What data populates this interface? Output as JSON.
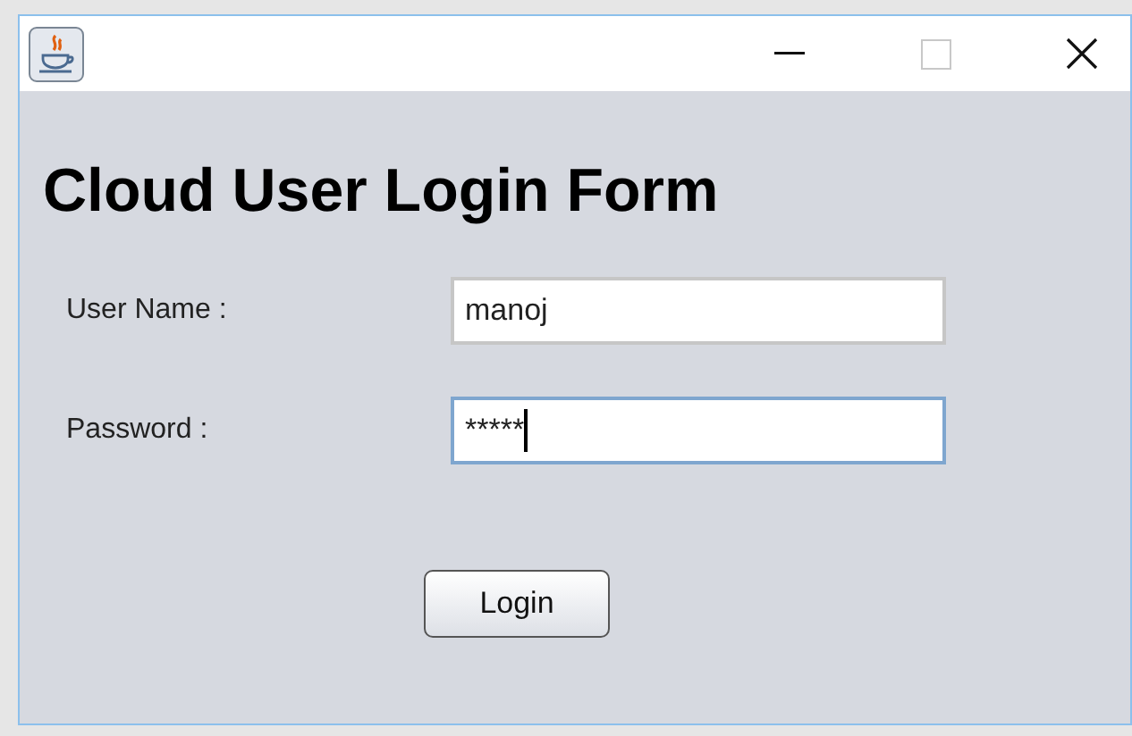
{
  "heading": "Cloud User Login Form",
  "fields": [
    {
      "label": "User Name :",
      "value": "manoj",
      "focused": false
    },
    {
      "label": "Password :",
      "value": "*****",
      "focused": true
    }
  ],
  "button": "Login"
}
